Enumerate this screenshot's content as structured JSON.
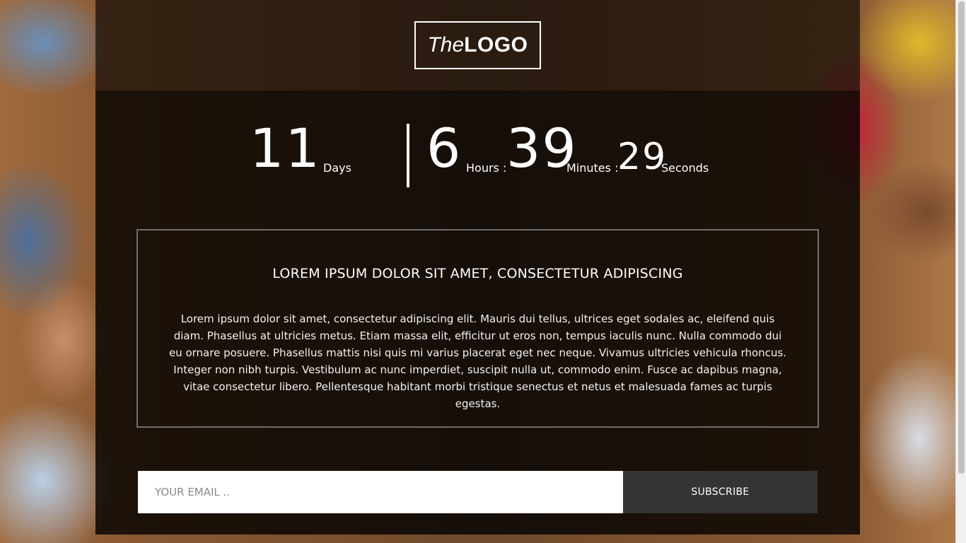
{
  "logo": {
    "prefix": "The",
    "main": "LOGO"
  },
  "countdown": {
    "days": {
      "value": "11",
      "label": "Days"
    },
    "hours": {
      "value": "6",
      "label": "Hours :"
    },
    "minutes": {
      "value": "39",
      "label": "Minutes :"
    },
    "seconds": {
      "value": "29",
      "label": "Seconds"
    }
  },
  "info": {
    "title": "LOREM IPSUM DOLOR SIT AMET, CONSECTETUR ADIPISCING",
    "body": "Lorem ipsum dolor sit amet, consectetur adipiscing elit. Mauris dui tellus, ultrices eget sodales ac, eleifend quis diam. Phasellus at ultricies metus. Etiam massa elit, efficitur ut eros non, tempus iaculis nunc. Nulla commodo dui eu ornare posuere. Phasellus mattis nisi quis mi varius placerat eget nec neque. Vivamus ultricies vehicula rhoncus. Integer non nibh turpis. Vestibulum ac nunc imperdiet, suscipit nulla ut, commodo enim. Fusce ac dapibus magna, vitae consectetur libero. Pellentesque habitant morbi tristique senectus et netus et malesuada fames ac turpis egestas."
  },
  "subscribe": {
    "email_placeholder": "YOUR EMAIL ..",
    "email_value": "",
    "button_label": "SUBSCRIBE"
  },
  "colors": {
    "overlay": "#000000",
    "text": "#ffffff",
    "button_bg": "#343434",
    "input_bg": "#ffffff"
  }
}
